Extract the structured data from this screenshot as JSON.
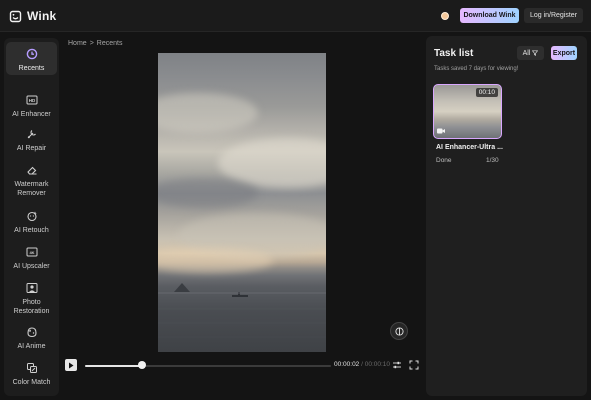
{
  "app": {
    "name": "Wink"
  },
  "header": {
    "download_label": "Download Wink",
    "login_label": "Log in/Register",
    "coin_icon": "coin-icon"
  },
  "sidebar": {
    "items": [
      {
        "label": "Recents",
        "icon": "recents-icon",
        "active": true
      },
      {
        "label": "AI Enhancer",
        "icon": "hd-icon"
      },
      {
        "label": "AI Repair",
        "icon": "repair-icon"
      },
      {
        "label": "Watermark Remover",
        "icon": "eraser-icon"
      },
      {
        "label": "AI Retouch",
        "icon": "retouch-icon"
      },
      {
        "label": "AI Upscaler",
        "icon": "upscaler-icon"
      },
      {
        "label": "Photo Restoration",
        "icon": "photo-icon"
      },
      {
        "label": "AI Anime",
        "icon": "anime-icon"
      },
      {
        "label": "Color Match",
        "icon": "color-match-icon"
      }
    ]
  },
  "breadcrumb": {
    "home": "Home",
    "separator": ">",
    "current": "Recents"
  },
  "player": {
    "current_time": "00:00:02",
    "separator": " / ",
    "duration": "00:00:10",
    "progress": 0.23
  },
  "task_panel": {
    "title": "Task list",
    "filter_label": "All",
    "export_label": "Export",
    "subtitle": "Tasks saved 7 days for viewing!",
    "tasks": [
      {
        "duration": "00:10",
        "name": "AI Enhancer-Ultra ...",
        "status": "Done",
        "progress": "1/30"
      }
    ]
  },
  "colors": {
    "accent_gradient_start": "#e6b8ff",
    "accent_gradient_end": "#9fd3ff",
    "background": "#141414"
  }
}
